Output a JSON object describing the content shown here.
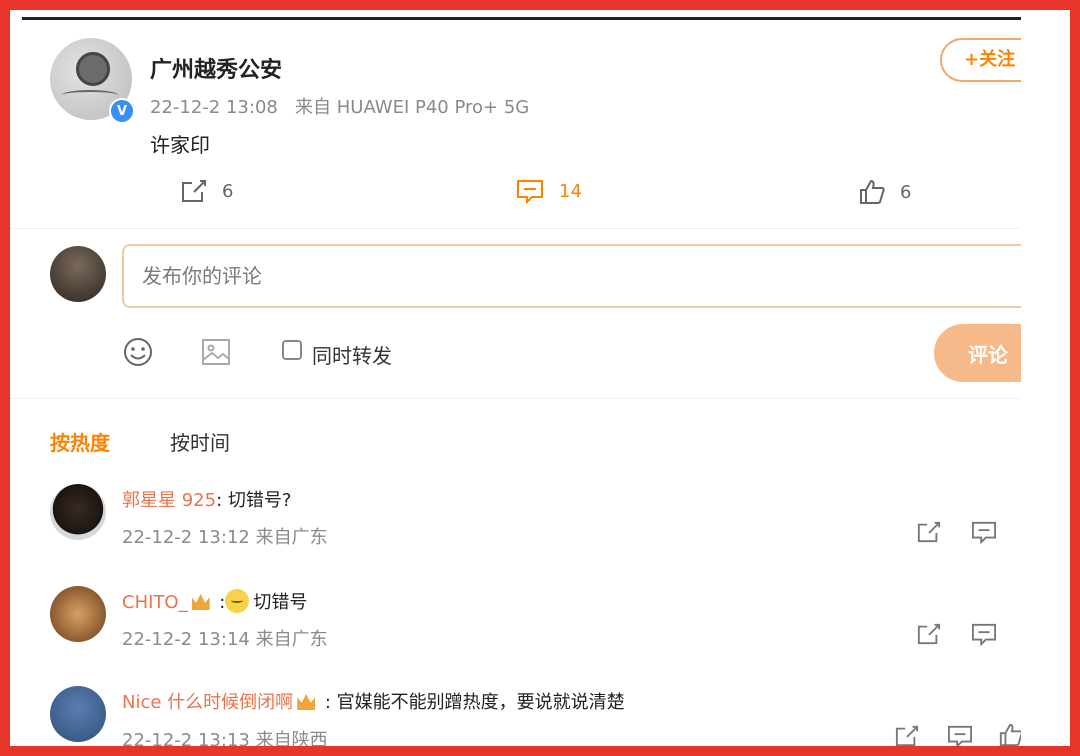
{
  "post": {
    "author": "广州越秀公安",
    "time": "22-12-2 13:08",
    "source": "来自 HUAWEI P40 Pro+ 5G",
    "text": "许家印",
    "follow_label": "+关注",
    "verified_mark": "V",
    "actions": {
      "repost_count": "6",
      "comment_count": "14",
      "like_count": "6"
    }
  },
  "composer": {
    "placeholder": "发布你的评论",
    "repost_label": "同时转发",
    "submit_label": "评论"
  },
  "sort_tabs": {
    "hot": "按热度",
    "time": "按时间"
  },
  "comments": [
    {
      "name": "郭星星 925",
      "text": ": 切错号?",
      "meta": "22-12-2 13:12 来自广东"
    },
    {
      "name": "CHITO_",
      "text": "切错号",
      "prefix": " :",
      "meta": "22-12-2 13:14 来自广东"
    },
    {
      "name": "Nice 什么时候倒闭啊",
      "text": " : 官媒能不能别蹭热度，要说就说清楚",
      "meta": "22-12-2 13:13 来自陕西"
    }
  ],
  "colors": {
    "accent": "#ff8200",
    "name": "#eb7350",
    "border": "#e8352a"
  }
}
